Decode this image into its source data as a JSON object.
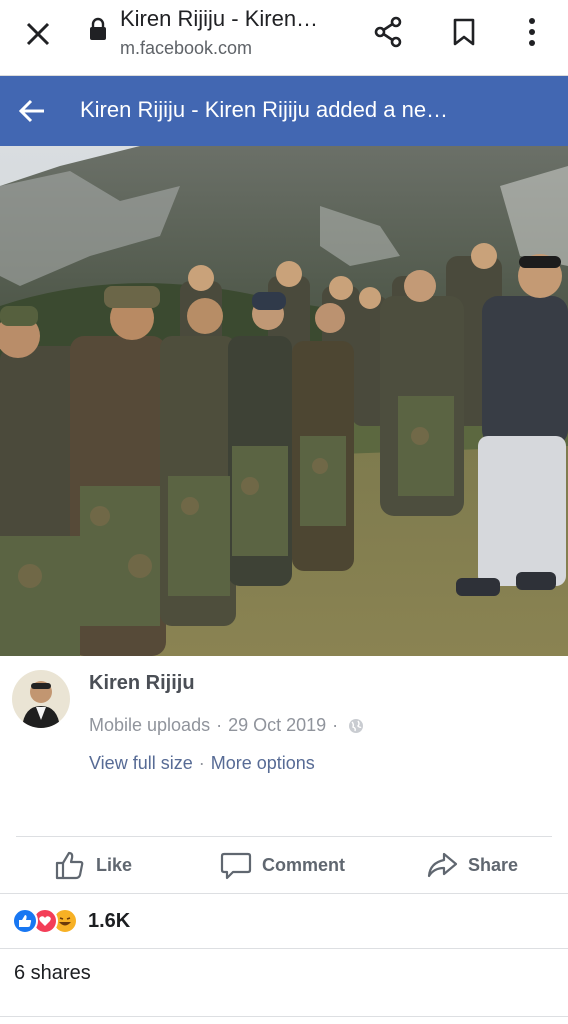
{
  "browser": {
    "title": "Kiren Rijiju - Kiren…",
    "url": "m.facebook.com",
    "icons": [
      "close-icon",
      "lock-icon",
      "share-icon",
      "bookmark-icon",
      "more-vert-icon"
    ]
  },
  "header": {
    "title": "Kiren Rijiju - Kiren Rijiju added a ne…",
    "background": "#4267b2"
  },
  "post": {
    "author": "Kiren Rijiju",
    "source": "Mobile uploads",
    "date": "29 Oct 2019",
    "separator": "·",
    "links": {
      "view_full_size": "View full size",
      "more_options": "More options"
    }
  },
  "actions": {
    "like": "Like",
    "comment": "Comment",
    "share": "Share"
  },
  "reactions": {
    "types": [
      "like",
      "love",
      "haha"
    ],
    "count": "1.6K"
  },
  "shares": "6 shares",
  "colors": {
    "link": "#576b95",
    "meta": "#90949c",
    "action": "#606770",
    "like_blue": "#1877f2",
    "love_red": "#f33e58",
    "haha_yellow": "#f7b125"
  }
}
